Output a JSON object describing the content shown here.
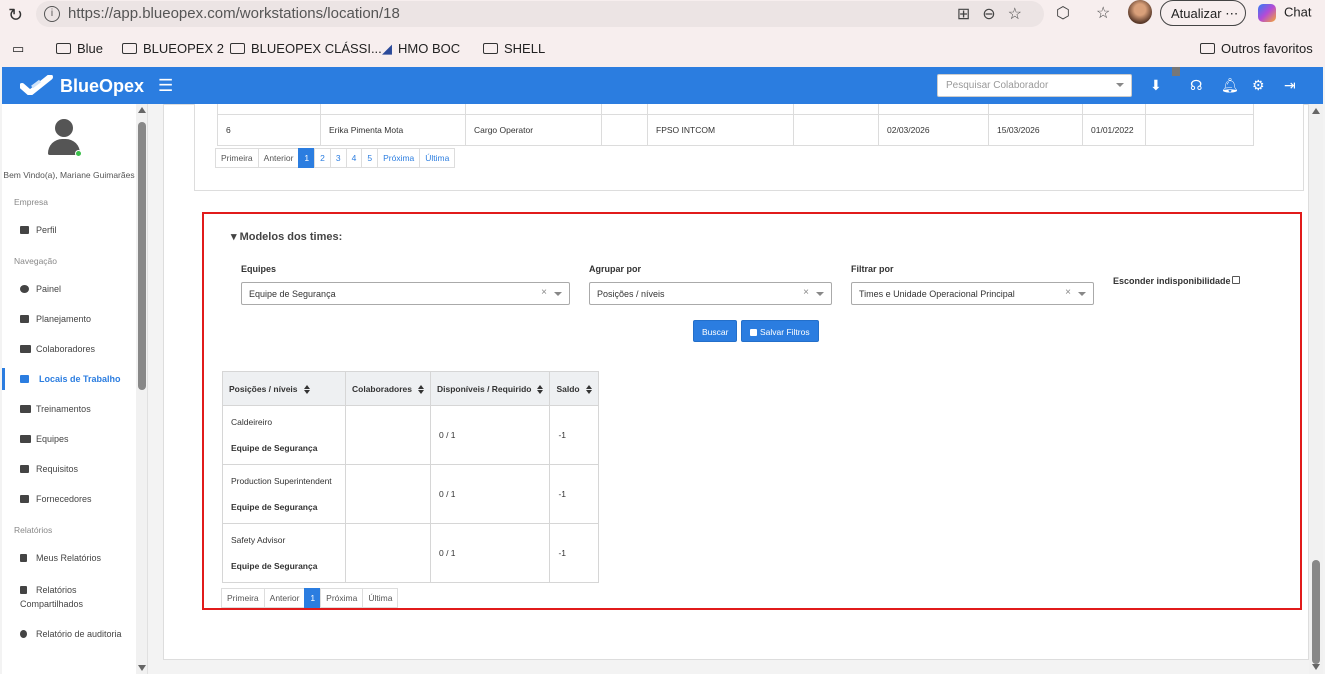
{
  "browser": {
    "url": "https://app.blueopex.com/workstations/location/18",
    "update_label": "Atualizar",
    "chat_label": "Chat",
    "favorites": [
      "Blue",
      "BLUEOPEX 2",
      "BLUEOPEX CLÁSSI...",
      "HMO BOC",
      "SHELL"
    ],
    "other_favorites": "Outros favoritos"
  },
  "header": {
    "brand": "BlueOpex",
    "search_placeholder": "Pesquisar Colaborador",
    "brand_color": "#2b7de0"
  },
  "sidebar": {
    "welcome": "Bem Vindo(a), Mariane Guimarães",
    "sections": {
      "empresa": "Empresa",
      "navegacao": "Navegação",
      "relatorios": "Relatórios"
    },
    "items": [
      {
        "label": "Perfil",
        "icon": "briefcase-icon"
      },
      {
        "label": "Painel",
        "icon": "dashboard-icon"
      },
      {
        "label": "Planejamento",
        "icon": "calendar-icon"
      },
      {
        "label": "Colaboradores",
        "icon": "users-icon"
      },
      {
        "label": "Locais de Trabalho",
        "icon": "building-icon",
        "active": true
      },
      {
        "label": "Treinamentos",
        "icon": "training-icon"
      },
      {
        "label": "Equipes",
        "icon": "team-icon"
      },
      {
        "label": "Requisitos",
        "icon": "checkbox-icon"
      },
      {
        "label": "Fornecedores",
        "icon": "briefcase-icon"
      },
      {
        "label": "Meus Relatórios",
        "icon": "report-icon"
      },
      {
        "label": "Relatórios Compartilhados",
        "icon": "share-icon"
      },
      {
        "label": "Relatório de auditoria",
        "icon": "search-icon"
      }
    ]
  },
  "top_table": {
    "row": {
      "index": "6",
      "name": "Erika Pimenta Mota",
      "role": "Cargo Operator",
      "col4": "",
      "location": "FPSO INTCOM",
      "col6": "",
      "date1": "02/03/2026",
      "date2": "15/03/2026",
      "date3": "01/01/2022"
    },
    "pager": {
      "first": "Primeira",
      "prev": "Anterior",
      "pages": [
        "1",
        "2",
        "3",
        "4",
        "5"
      ],
      "next": "Próxima",
      "last": "Última"
    }
  },
  "models": {
    "title": "▾ Modelos dos times:",
    "equipes_label": "Equipes",
    "equipes_value": "Equipe de Segurança",
    "agrupar_label": "Agrupar por",
    "agrupar_value": "Posições / níveis",
    "filtrar_label": "Filtrar por",
    "filtrar_value": "Times e Unidade Operacional Principal",
    "esconder_label": "Esconder indisponibilidade",
    "buscar_label": "Buscar",
    "salvar_label": "Salvar Filtros",
    "columns": [
      "Posições / níveis",
      "Colaboradores",
      "Disponíveis / Requirido",
      "Saldo"
    ],
    "rows": [
      {
        "position": "Caldeireiro",
        "team": "Equipe de Segurança",
        "collaborators": "",
        "available": "0 / 1",
        "balance": "-1"
      },
      {
        "position": "Production Superintendent",
        "team": "Equipe de Segurança",
        "collaborators": "",
        "available": "0 / 1",
        "balance": "-1"
      },
      {
        "position": "Safety Advisor",
        "team": "Equipe de Segurança",
        "collaborators": "",
        "available": "0 / 1",
        "balance": "-1"
      }
    ],
    "pager": {
      "first": "Primeira",
      "prev": "Anterior",
      "page": "1",
      "next": "Próxima",
      "last": "Última"
    }
  }
}
